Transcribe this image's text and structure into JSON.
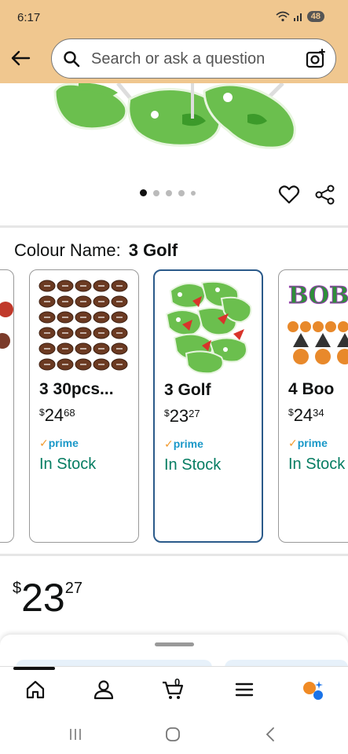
{
  "status_bar": {
    "time": "6:17",
    "battery": "48"
  },
  "search": {
    "placeholder": "Search or ask a question"
  },
  "gallery": {
    "dot_count": 5,
    "active_index": 0
  },
  "colour": {
    "label": "Colour Name:",
    "value": "3 Golf"
  },
  "variants": [
    {
      "title": "3 30pcs...",
      "price_whole": "24",
      "price_fraction": "68",
      "prime": "prime",
      "stock": "In Stock",
      "selected": false
    },
    {
      "title": "3 Golf",
      "price_whole": "23",
      "price_fraction": "27",
      "prime": "prime",
      "stock": "In Stock",
      "selected": true
    },
    {
      "title": "4 Boo",
      "price_whole": "24",
      "price_fraction": "34",
      "prime": "prime",
      "stock": "In Stock",
      "selected": false
    }
  ],
  "price": {
    "currency": "$",
    "whole": "23",
    "fraction": "27"
  },
  "nav": {
    "cart_count": "0",
    "items": [
      "home-icon",
      "account-icon",
      "cart-icon",
      "menu-icon",
      "rufus-icon"
    ]
  },
  "colors": {
    "header_bg": "#f0c78f",
    "prime_blue": "#1a98c8",
    "stock_green": "#067d62",
    "selected_border": "#2b5a8a"
  }
}
